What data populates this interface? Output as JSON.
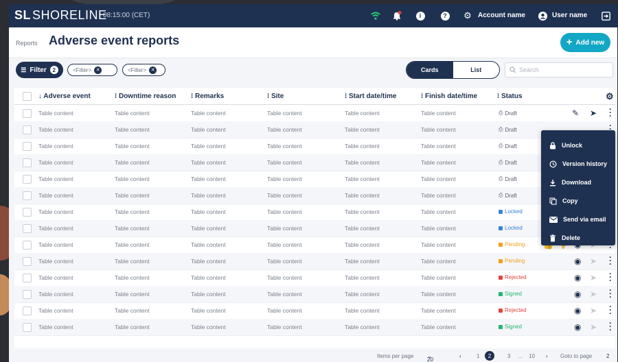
{
  "app": {
    "brand_mark": "SL",
    "brand_name": "SHORELINE",
    "clock": "08:15:00 (CET)",
    "account_label": "Account name",
    "user_label": "User name"
  },
  "icons": [
    "wifi-icon",
    "bell-icon",
    "info-icon",
    "help-icon",
    "gear-icon",
    "user-icon",
    "logout-icon",
    "plus-icon",
    "search-icon",
    "lock-icon",
    "history-icon",
    "download-icon",
    "copy-icon",
    "mail-icon",
    "trash-icon",
    "pencil-icon",
    "send-icon",
    "eye-icon",
    "thumbs-up-icon",
    "thumbs-down-icon",
    "kebab-icon"
  ],
  "header": {
    "breadcrumb": "Reports",
    "title": "Adverse event reports",
    "add_button": "Add new"
  },
  "filters": {
    "filter_button": "Filter",
    "filter_count": "2",
    "chips": [
      "<Filter>",
      "<Filter>"
    ],
    "view_toggle": [
      "Cards",
      "List"
    ],
    "active_view": "Cards",
    "search_placeholder": "Search"
  },
  "table": {
    "columns": [
      "Adverse event",
      "Downtime reason",
      "Remarks",
      "Site",
      "Start date/time",
      "Finish date/time",
      "Status"
    ],
    "cell_text": "Table content",
    "rows": [
      {
        "status": "Draft",
        "actions": [
          "edit",
          "send"
        ]
      },
      {
        "status": "Draft",
        "actions": []
      },
      {
        "status": "Draft",
        "actions": []
      },
      {
        "status": "Draft",
        "actions": []
      },
      {
        "status": "Draft",
        "actions": []
      },
      {
        "status": "Draft",
        "actions": []
      },
      {
        "status": "Locked",
        "actions": []
      },
      {
        "status": "Locked",
        "actions": []
      },
      {
        "status": "Pending",
        "actions": [
          "approve",
          "reject",
          "view",
          "send"
        ]
      },
      {
        "status": "Pending",
        "actions": [
          "view",
          "send"
        ]
      },
      {
        "status": "Rejected",
        "actions": [
          "view",
          "send"
        ]
      },
      {
        "status": "Signed",
        "actions": [
          "view",
          "send"
        ]
      },
      {
        "status": "Rejected",
        "actions": [
          "view",
          "send"
        ]
      },
      {
        "status": "Signed",
        "actions": [
          "view",
          "send"
        ]
      }
    ]
  },
  "status_colors": {
    "Draft": "#5a6070",
    "Locked": "#3b82d6",
    "Pending": "#f0a020",
    "Rejected": "#e0453d",
    "Signed": "#22b573"
  },
  "context_menu": [
    "Unlock",
    "Version history",
    "Download",
    "Copy",
    "Send via email",
    "Delete"
  ],
  "pagination": {
    "items_per_page_label": "Items per page",
    "items_per_page": "20",
    "pages": [
      "1",
      "2",
      "3",
      "...",
      "10"
    ],
    "current_page": "2",
    "goto_label": "Goto to page",
    "goto_value": "2"
  },
  "colors": {
    "navy": "#1f3151",
    "accent": "#13a7c6"
  }
}
